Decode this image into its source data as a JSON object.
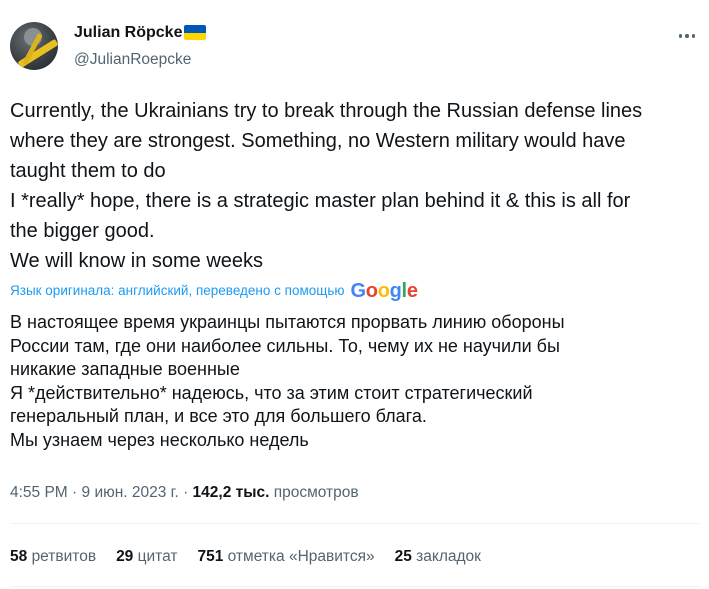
{
  "author": {
    "display_name": "Julian Röpcke",
    "handle": "@JulianRoepcke",
    "flag_icon": "ukraine-flag-icon",
    "flag_colors": [
      "#0057b7",
      "#ffd700"
    ]
  },
  "tweet": {
    "lines": [
      "Currently, the Ukrainians try to break through the Russian defense lines",
      "where they are strongest. Something, no Western military would have",
      "taught them to do",
      "I *really* hope, there is a strategic master plan behind it & this is all for",
      "the bigger good.",
      "We will know in some weeks"
    ],
    "translation_notice": "Язык оригинала: английский, переведено с помощью",
    "translation_provider": [
      "G",
      "o",
      "o",
      "g",
      "l",
      "e"
    ],
    "translated_lines": [
      "В настоящее время украинцы пытаются прорвать линию обороны",
      "России там, где они наиболее сильны. То, чему их не научили бы",
      "никакие западные военные",
      "Я *действительно* надеюсь, что за этим стоит стратегический",
      "генеральный план, и все это для большего блага.",
      "Мы узнаем через несколько недель"
    ]
  },
  "meta": {
    "time": "4:55 PM",
    "separator": " · ",
    "date": "9 июн. 2023 г.",
    "views_count": "142,2 тыс.",
    "views_label": "просмотров"
  },
  "stats": {
    "retweets_count": "58",
    "retweets_label": "ретвитов",
    "quotes_count": "29",
    "quotes_label": "цитат",
    "likes_count": "751",
    "likes_label": "отметка «Нравится»",
    "bookmarks_count": "25",
    "bookmarks_label": "закладок"
  },
  "colors": {
    "link": "#1d9bf0",
    "secondary_text": "#536471",
    "primary_text": "#0f1419"
  }
}
